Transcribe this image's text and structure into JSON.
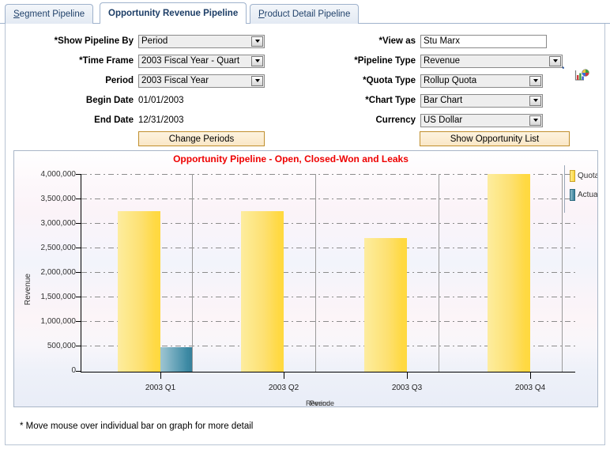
{
  "tabs": [
    {
      "label": "Segment Pipeline",
      "first": "S",
      "rest": "egment Pipeline",
      "active": false
    },
    {
      "label": "Opportunity Revenue Pipeline",
      "first": "O",
      "rest": "pportunity Revenue Pipeline",
      "active": true
    },
    {
      "label": "Product Detail Pipeline",
      "first": "P",
      "rest": "roduct Detail Pipeline",
      "active": false
    }
  ],
  "form": {
    "left": [
      {
        "label": "*Show Pipeline By",
        "value": "Period",
        "type": "select"
      },
      {
        "label": "*Time Frame",
        "value": "2003 Fiscal Year - Quart",
        "type": "select"
      },
      {
        "label": "Period",
        "value": "2003 Fiscal Year",
        "type": "select"
      },
      {
        "label": "Begin Date",
        "value": "01/01/2003",
        "type": "text"
      },
      {
        "label": "End Date",
        "value": "12/31/2003",
        "type": "text"
      }
    ],
    "right": [
      {
        "label": "*View as",
        "value": "Stu Marx",
        "type": "input"
      },
      {
        "label": "*Pipeline Type",
        "value": "Revenue",
        "type": "select"
      },
      {
        "label": "*Quota Type",
        "value": "Rollup Quota",
        "type": "select"
      },
      {
        "label": "*Chart Type",
        "value": "Bar Chart",
        "type": "select"
      },
      {
        "label": "Currency",
        "value": "US Dollar",
        "type": "select"
      }
    ],
    "lookup_icon": "magnifier-icon",
    "chart_icon": "chart-icon"
  },
  "buttons": {
    "change_periods": "Change Periods",
    "show_opportunity_list": "Show Opportunity List"
  },
  "footnote": "* Move mouse over individual bar on graph for more detail",
  "colors": {
    "title": "#ee0000",
    "quota": "#ffd93f",
    "actual": "#37809a",
    "button_border": "#c08f2e",
    "tab_border": "#9fb2cc"
  },
  "chart_data": {
    "type": "bar",
    "title": "Opportunity Pipeline - Open, Closed-Won and Leaks",
    "xlabel": "Period",
    "xlabel_overlap": "Revenue",
    "ylabel": "Revenue",
    "categories": [
      "2003 Q1",
      "2003 Q2",
      "2003 Q3",
      "2003 Q4"
    ],
    "series": [
      {
        "name": "Quota",
        "color": "#ffd93f",
        "values": [
          3250000,
          3250000,
          2700000,
          4000000
        ]
      },
      {
        "name": "Actual",
        "color": "#37809a",
        "values": [
          500000,
          0,
          0,
          0
        ]
      }
    ],
    "ylim": [
      0,
      4000000
    ],
    "ytick_step": 500000,
    "yticks": [
      "0",
      "500,000",
      "1,000,000",
      "1,500,000",
      "2,000,000",
      "2,500,000",
      "3,000,000",
      "3,500,000",
      "4,000,000"
    ],
    "grid": true,
    "legend_position": "right",
    "legend": [
      "Quota",
      "Actual"
    ]
  }
}
